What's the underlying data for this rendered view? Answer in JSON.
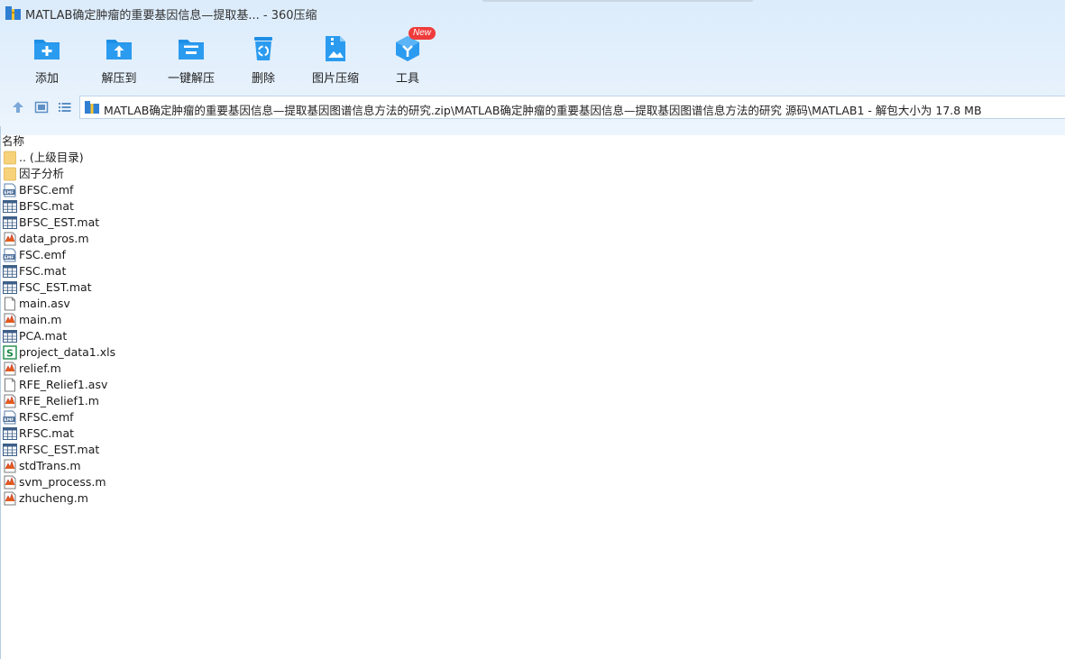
{
  "window": {
    "title": "MATLAB确定肿瘤的重要基因信息—提取基... - 360压缩"
  },
  "toolbar": {
    "add": "添加",
    "extract_to": "解压到",
    "one_click_extract": "一键解压",
    "delete": "删除",
    "image_compress": "图片压缩",
    "tools": "工具",
    "new_badge": "New"
  },
  "address": {
    "path": "MATLAB确定肿瘤的重要基因信息—提取基因图谱信息方法的研究.zip\\MATLAB确定肿瘤的重要基因信息—提取基因图谱信息方法的研究 源码\\MATLAB1 - 解包大小为 17.8 MB"
  },
  "list": {
    "column_name": "名称",
    "files": [
      {
        "name": ".. (上级目录)",
        "icon": "folder-icon"
      },
      {
        "name": "因子分析",
        "icon": "folder-icon"
      },
      {
        "name": "BFSC.emf",
        "icon": "emf-file-icon"
      },
      {
        "name": "BFSC.mat",
        "icon": "mat-file-icon"
      },
      {
        "name": "BFSC_EST.mat",
        "icon": "mat-file-icon"
      },
      {
        "name": "data_pros.m",
        "icon": "matlab-m-file-icon"
      },
      {
        "name": "FSC.emf",
        "icon": "emf-file-icon"
      },
      {
        "name": "FSC.mat",
        "icon": "mat-file-icon"
      },
      {
        "name": "FSC_EST.mat",
        "icon": "mat-file-icon"
      },
      {
        "name": "main.asv",
        "icon": "blank-file-icon"
      },
      {
        "name": "main.m",
        "icon": "matlab-m-file-icon"
      },
      {
        "name": "PCA.mat",
        "icon": "mat-file-icon"
      },
      {
        "name": "project_data1.xls",
        "icon": "xls-file-icon"
      },
      {
        "name": "relief.m",
        "icon": "matlab-m-file-icon"
      },
      {
        "name": "RFE_Relief1.asv",
        "icon": "blank-file-icon"
      },
      {
        "name": "RFE_Relief1.m",
        "icon": "matlab-m-file-icon"
      },
      {
        "name": "RFSC.emf",
        "icon": "emf-file-icon"
      },
      {
        "name": "RFSC.mat",
        "icon": "mat-file-icon"
      },
      {
        "name": "RFSC_EST.mat",
        "icon": "mat-file-icon"
      },
      {
        "name": "stdTrans.m",
        "icon": "matlab-m-file-icon"
      },
      {
        "name": "svm_process.m",
        "icon": "matlab-m-file-icon"
      },
      {
        "name": "zhucheng.m",
        "icon": "matlab-m-file-icon"
      }
    ]
  },
  "colors": {
    "accent_blue": "#1e8fe6",
    "badge_red": "#ef3b3b",
    "folder_yellow": "#f7d27a"
  }
}
